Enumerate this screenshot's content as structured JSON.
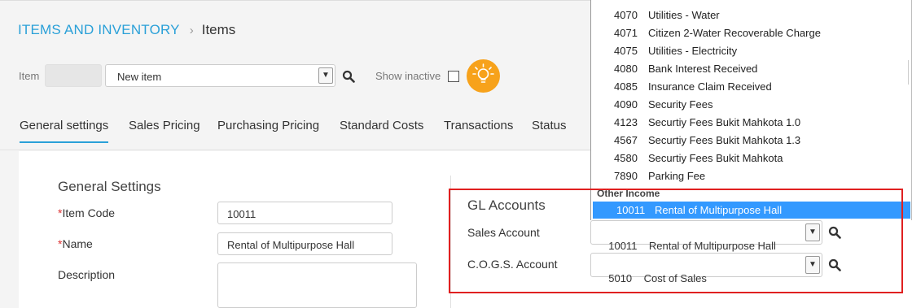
{
  "breadcrumb": {
    "section": "ITEMS AND INVENTORY",
    "separator": "›",
    "current": "Items"
  },
  "filter": {
    "item_label": "Item",
    "item_code_value": "",
    "item_select_value": "New item",
    "show_inactive_label": "Show inactive",
    "show_inactive_checked": false
  },
  "tabs": [
    {
      "label": "General settings",
      "active": true
    },
    {
      "label": "Sales Pricing"
    },
    {
      "label": "Purchasing Pricing"
    },
    {
      "label": "Standard Costs"
    },
    {
      "label": "Transactions"
    },
    {
      "label": "Status"
    }
  ],
  "general": {
    "title": "General Settings",
    "required_mark": "*",
    "item_code_label": "Item Code",
    "item_code_value": "10011",
    "name_label": "Name",
    "name_value": "Rental of Multipurpose Hall",
    "description_label": "Description",
    "description_value": ""
  },
  "gl": {
    "title": "GL Accounts",
    "sales_label": "Sales Account",
    "sales_value": "10011    Rental of Multipurpose Hall",
    "cogs_label": "C.O.G.S. Account",
    "cogs_value": "5010    Cost of Sales"
  },
  "dropdown": {
    "items": [
      {
        "code": "4070",
        "name": "Utilities - Water"
      },
      {
        "code": "4071",
        "name": "Citizen 2-Water Recoverable Charge"
      },
      {
        "code": "4075",
        "name": "Utilities - Electricity"
      },
      {
        "code": "4080",
        "name": "Bank Interest Received"
      },
      {
        "code": "4085",
        "name": "Insurance Claim Received"
      },
      {
        "code": "4090",
        "name": "Security Fees"
      },
      {
        "code": "4123",
        "name": "Securtiy Fees Bukit Mahkota 1.0"
      },
      {
        "code": "4567",
        "name": "Securtiy Fees Bukit Mahkota 1.3"
      },
      {
        "code": "4580",
        "name": "Securtiy Fees Bukit Mahkota"
      },
      {
        "code": "7890",
        "name": "Parking Fee"
      }
    ],
    "group_label": "Other Income",
    "selected": {
      "code": "10011",
      "name": "Rental of Multipurpose Hall"
    }
  },
  "colors": {
    "accent": "#2aa0d8",
    "selection": "#3399ff",
    "highlight_border": "#e02020",
    "bulb": "#f7a21b"
  },
  "icons": {
    "search": "search-icon",
    "bulb": "lightbulb-icon",
    "dropdown": "chevron-down-icon"
  }
}
